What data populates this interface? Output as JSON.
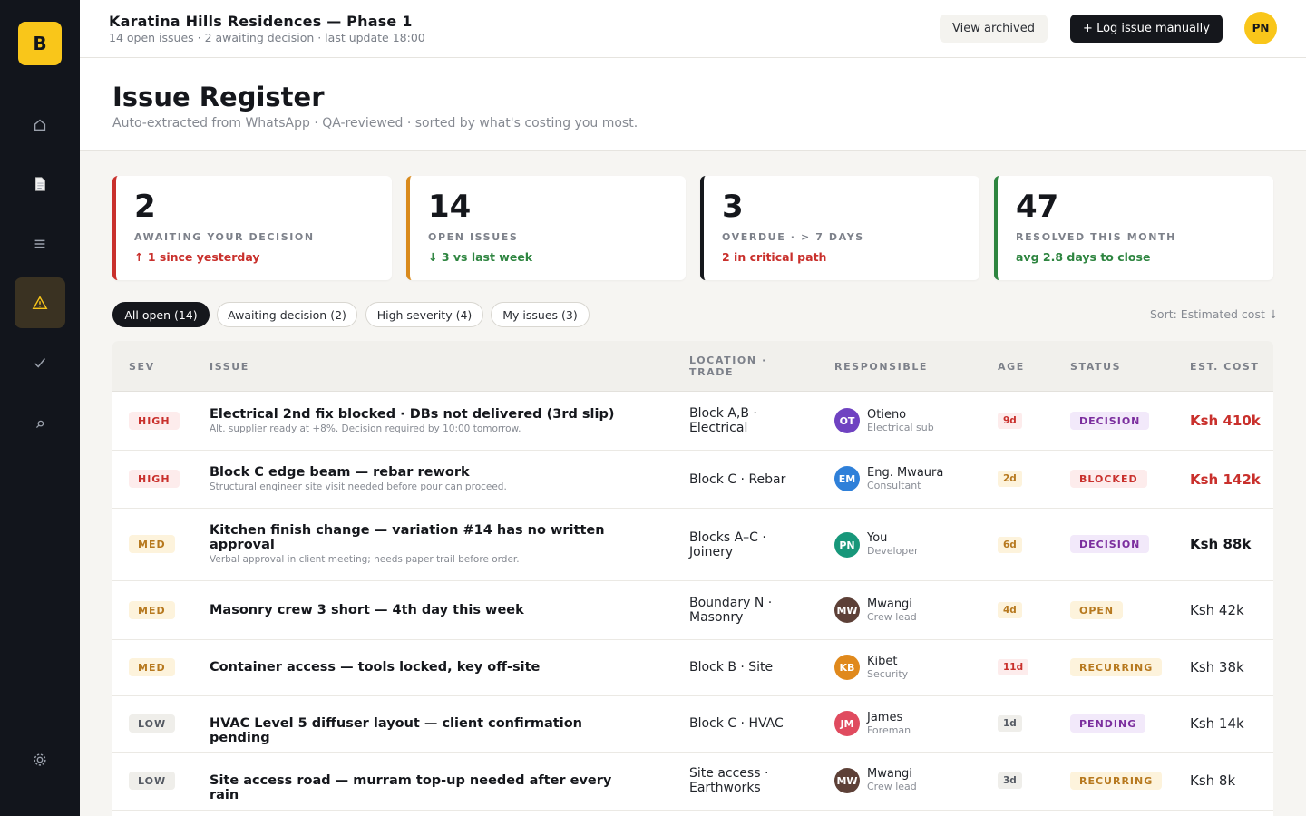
{
  "sidebar": {
    "logo": "B",
    "items": [
      {
        "icon": "home-icon"
      },
      {
        "icon": "document-icon"
      },
      {
        "icon": "list-icon"
      },
      {
        "icon": "warning-icon",
        "active": true
      },
      {
        "icon": "check-icon"
      },
      {
        "icon": "search-icon"
      },
      {
        "icon": "gear-icon"
      }
    ]
  },
  "topbar": {
    "project_title": "Karatina Hills Residences — Phase 1",
    "project_sub": "14 open issues · 2 awaiting decision · last update 18:00",
    "view_archived": "View archived",
    "log_issue": "+ Log issue manually",
    "user_initials": "PN"
  },
  "header": {
    "title": "Issue Register",
    "subtitle": "Auto-extracted from WhatsApp · QA-reviewed · sorted by what's costing you most."
  },
  "kpis": [
    {
      "value": "2",
      "label": "AWAITING YOUR DECISION",
      "note": "↑ 1 since yesterday",
      "accent": "#c9302c"
    },
    {
      "value": "14",
      "label": "OPEN ISSUES",
      "note": "↓ 3 vs last week",
      "accent": "#d98a1c"
    },
    {
      "value": "3",
      "label": "OVERDUE · > 7 DAYS",
      "note": "2 in critical path",
      "accent": "#15171c"
    },
    {
      "value": "47",
      "label": "RESOLVED THIS MONTH",
      "note": "avg 2.8 days to close",
      "accent": "#2e8540"
    }
  ],
  "filters": [
    "All open (14)",
    "Awaiting decision (2)",
    "High severity (4)",
    "My issues (3)"
  ],
  "sort_label": "Sort: Estimated cost ↓",
  "table": {
    "headers": {
      "sev": "SEV",
      "issue": "ISSUE",
      "location_1": "LOCATION ·",
      "location_2": "TRADE",
      "responsible": "RESPONSIBLE",
      "age": "AGE",
      "status": "STATUS",
      "cost": "EST. COST"
    },
    "rows": [
      {
        "sev": "HIGH",
        "title": "Electrical 2nd fix blocked · DBs not delivered (3rd slip)",
        "desc": "Alt. supplier ready at +8%. Decision required by 10:00 tomorrow.",
        "location": "Block A,B · Electrical",
        "initials": "OT",
        "avatar_color": "#6f42c1",
        "name": "Otieno",
        "role": "Electrical sub",
        "age": "9d",
        "status": "DECISION",
        "cost": "Ksh 410k"
      },
      {
        "sev": "HIGH",
        "title": "Block C edge beam — rebar rework",
        "desc": "Structural engineer site visit needed before pour can proceed.",
        "location": "Block C · Rebar",
        "initials": "EM",
        "avatar_color": "#2f80d9",
        "name": "Eng. Mwaura",
        "role": "Consultant",
        "age": "2d",
        "status": "BLOCKED",
        "cost": "Ksh 142k"
      },
      {
        "sev": "MED",
        "title": "Kitchen finish change — variation #14 has no written approval",
        "desc": "Verbal approval in client meeting; needs paper trail before order.",
        "location": "Blocks A–C · Joinery",
        "initials": "PN",
        "avatar_color": "#17977a",
        "name": "You",
        "role": "Developer",
        "age": "6d",
        "status": "DECISION",
        "cost": "Ksh 88k"
      },
      {
        "sev": "MED",
        "title": "Masonry crew 3 short — 4th day this week",
        "desc": "",
        "location": "Boundary N · Masonry",
        "initials": "MW",
        "avatar_color": "#5d4037",
        "name": "Mwangi",
        "role": "Crew lead",
        "age": "4d",
        "status": "OPEN",
        "cost": "Ksh 42k"
      },
      {
        "sev": "MED",
        "title": "Container access — tools locked, key off-site",
        "desc": "",
        "location": "Block B · Site",
        "initials": "KB",
        "avatar_color": "#e0891c",
        "name": "Kibet",
        "role": "Security",
        "age": "11d",
        "status": "RECURRING",
        "cost": "Ksh 38k"
      },
      {
        "sev": "LOW",
        "title": "HVAC Level 5 diffuser layout — client confirmation pending",
        "desc": "",
        "location": "Block C · HVAC",
        "initials": "JM",
        "avatar_color": "#e04b5f",
        "name": "James",
        "role": "Foreman",
        "age": "1d",
        "status": "PENDING",
        "cost": "Ksh 14k"
      },
      {
        "sev": "LOW",
        "title": "Site access road — murram top-up needed after every rain",
        "desc": "",
        "location": "Site access · Earthworks",
        "initials": "MW",
        "avatar_color": "#5d4037",
        "name": "Mwangi",
        "role": "Crew lead",
        "age": "3d",
        "status": "RECURRING",
        "cost": "Ksh 8k"
      }
    ]
  }
}
